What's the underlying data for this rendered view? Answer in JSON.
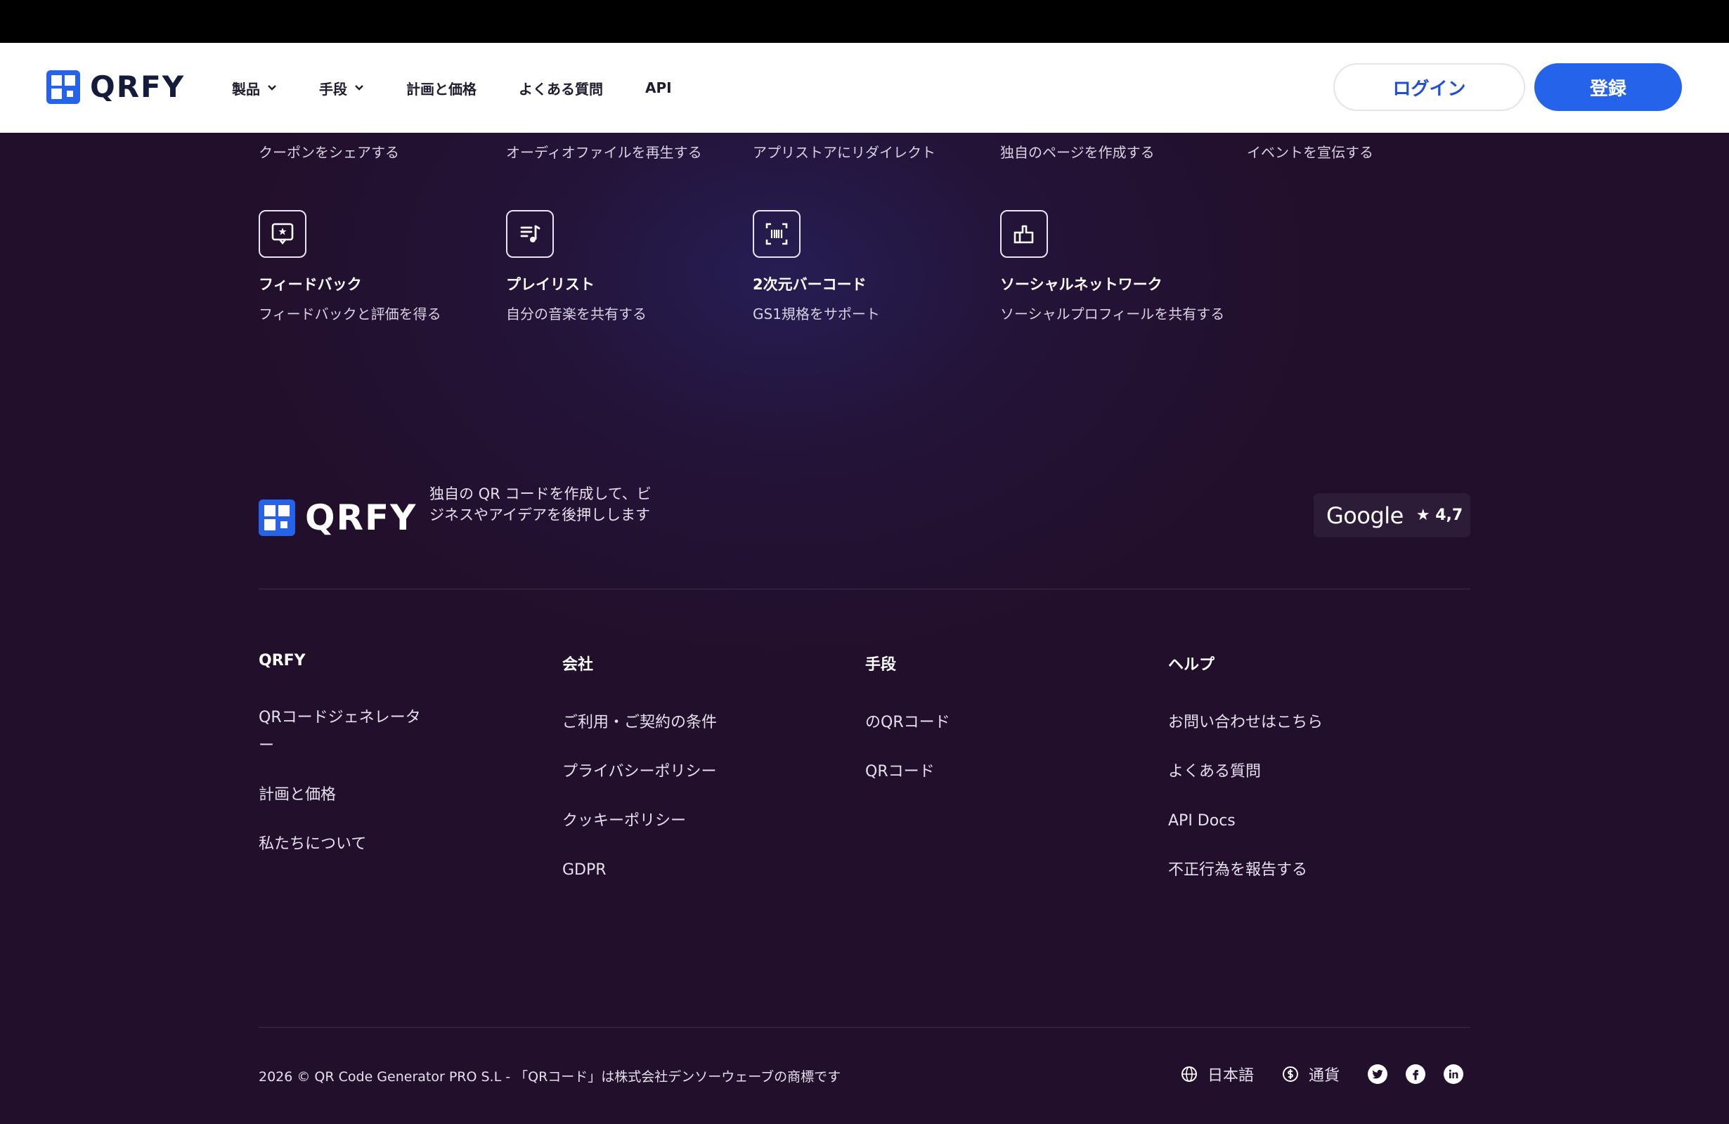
{
  "header": {
    "logo_text": "QRFY",
    "nav": [
      {
        "label": "製品",
        "has_dropdown": true
      },
      {
        "label": "手段",
        "has_dropdown": true
      },
      {
        "label": "計画と価格",
        "has_dropdown": false
      },
      {
        "label": "よくある質問",
        "has_dropdown": false
      },
      {
        "label": "API",
        "has_dropdown": false
      }
    ],
    "login_label": "ログイン",
    "register_label": "登録"
  },
  "partial_row": [
    "クーポンをシェアする",
    "オーディオファイルを再生する",
    "アプリストアにリダイレクト",
    "独自のページを作成する",
    "イベントを宣伝する"
  ],
  "features": [
    {
      "icon": "feedback-icon",
      "title": "フィードバック",
      "desc": "フィードバックと評価を得る"
    },
    {
      "icon": "playlist-icon",
      "title": "プレイリスト",
      "desc": "自分の音楽を共有する"
    },
    {
      "icon": "barcode-icon",
      "title": "2次元バーコード",
      "desc": "GS1規格をサポート"
    },
    {
      "icon": "thumbs-up-icon",
      "title": "ソーシャルネットワーク",
      "desc": "ソーシャルプロフィールを共有する"
    }
  ],
  "footer": {
    "logo_text": "QRFY",
    "tagline": "独自の QR コードを作成して、ビジネスやアイデアを後押しします",
    "google": {
      "label": "Google",
      "rating": "★ 4,7"
    },
    "columns": [
      {
        "title": "QRFY",
        "links": [
          "QRコードジェネレーター",
          "計画と価格",
          "私たちについて"
        ]
      },
      {
        "title": "会社",
        "links": [
          "ご利用・ご契約の条件",
          "プライバシーポリシー",
          "クッキーポリシー",
          "GDPR"
        ]
      },
      {
        "title": "手段",
        "links": [
          "のQRコード",
          "QRコード"
        ]
      },
      {
        "title": "ヘルプ",
        "links": [
          "お問い合わせはこちら",
          "よくある質問",
          "API Docs",
          "不正行為を報告する"
        ]
      }
    ],
    "copyright": "2026 © QR Code Generator PRO S.L - 「QRコード」は株式会社デンソーウェーブの商標です",
    "language_label": "日本語",
    "currency_label": "通貨",
    "social": [
      "twitter-icon",
      "facebook-icon",
      "linkedin-icon"
    ]
  },
  "colors": {
    "accent": "#2563eb",
    "background": "#220f2b",
    "header_bg": "#ffffff"
  }
}
